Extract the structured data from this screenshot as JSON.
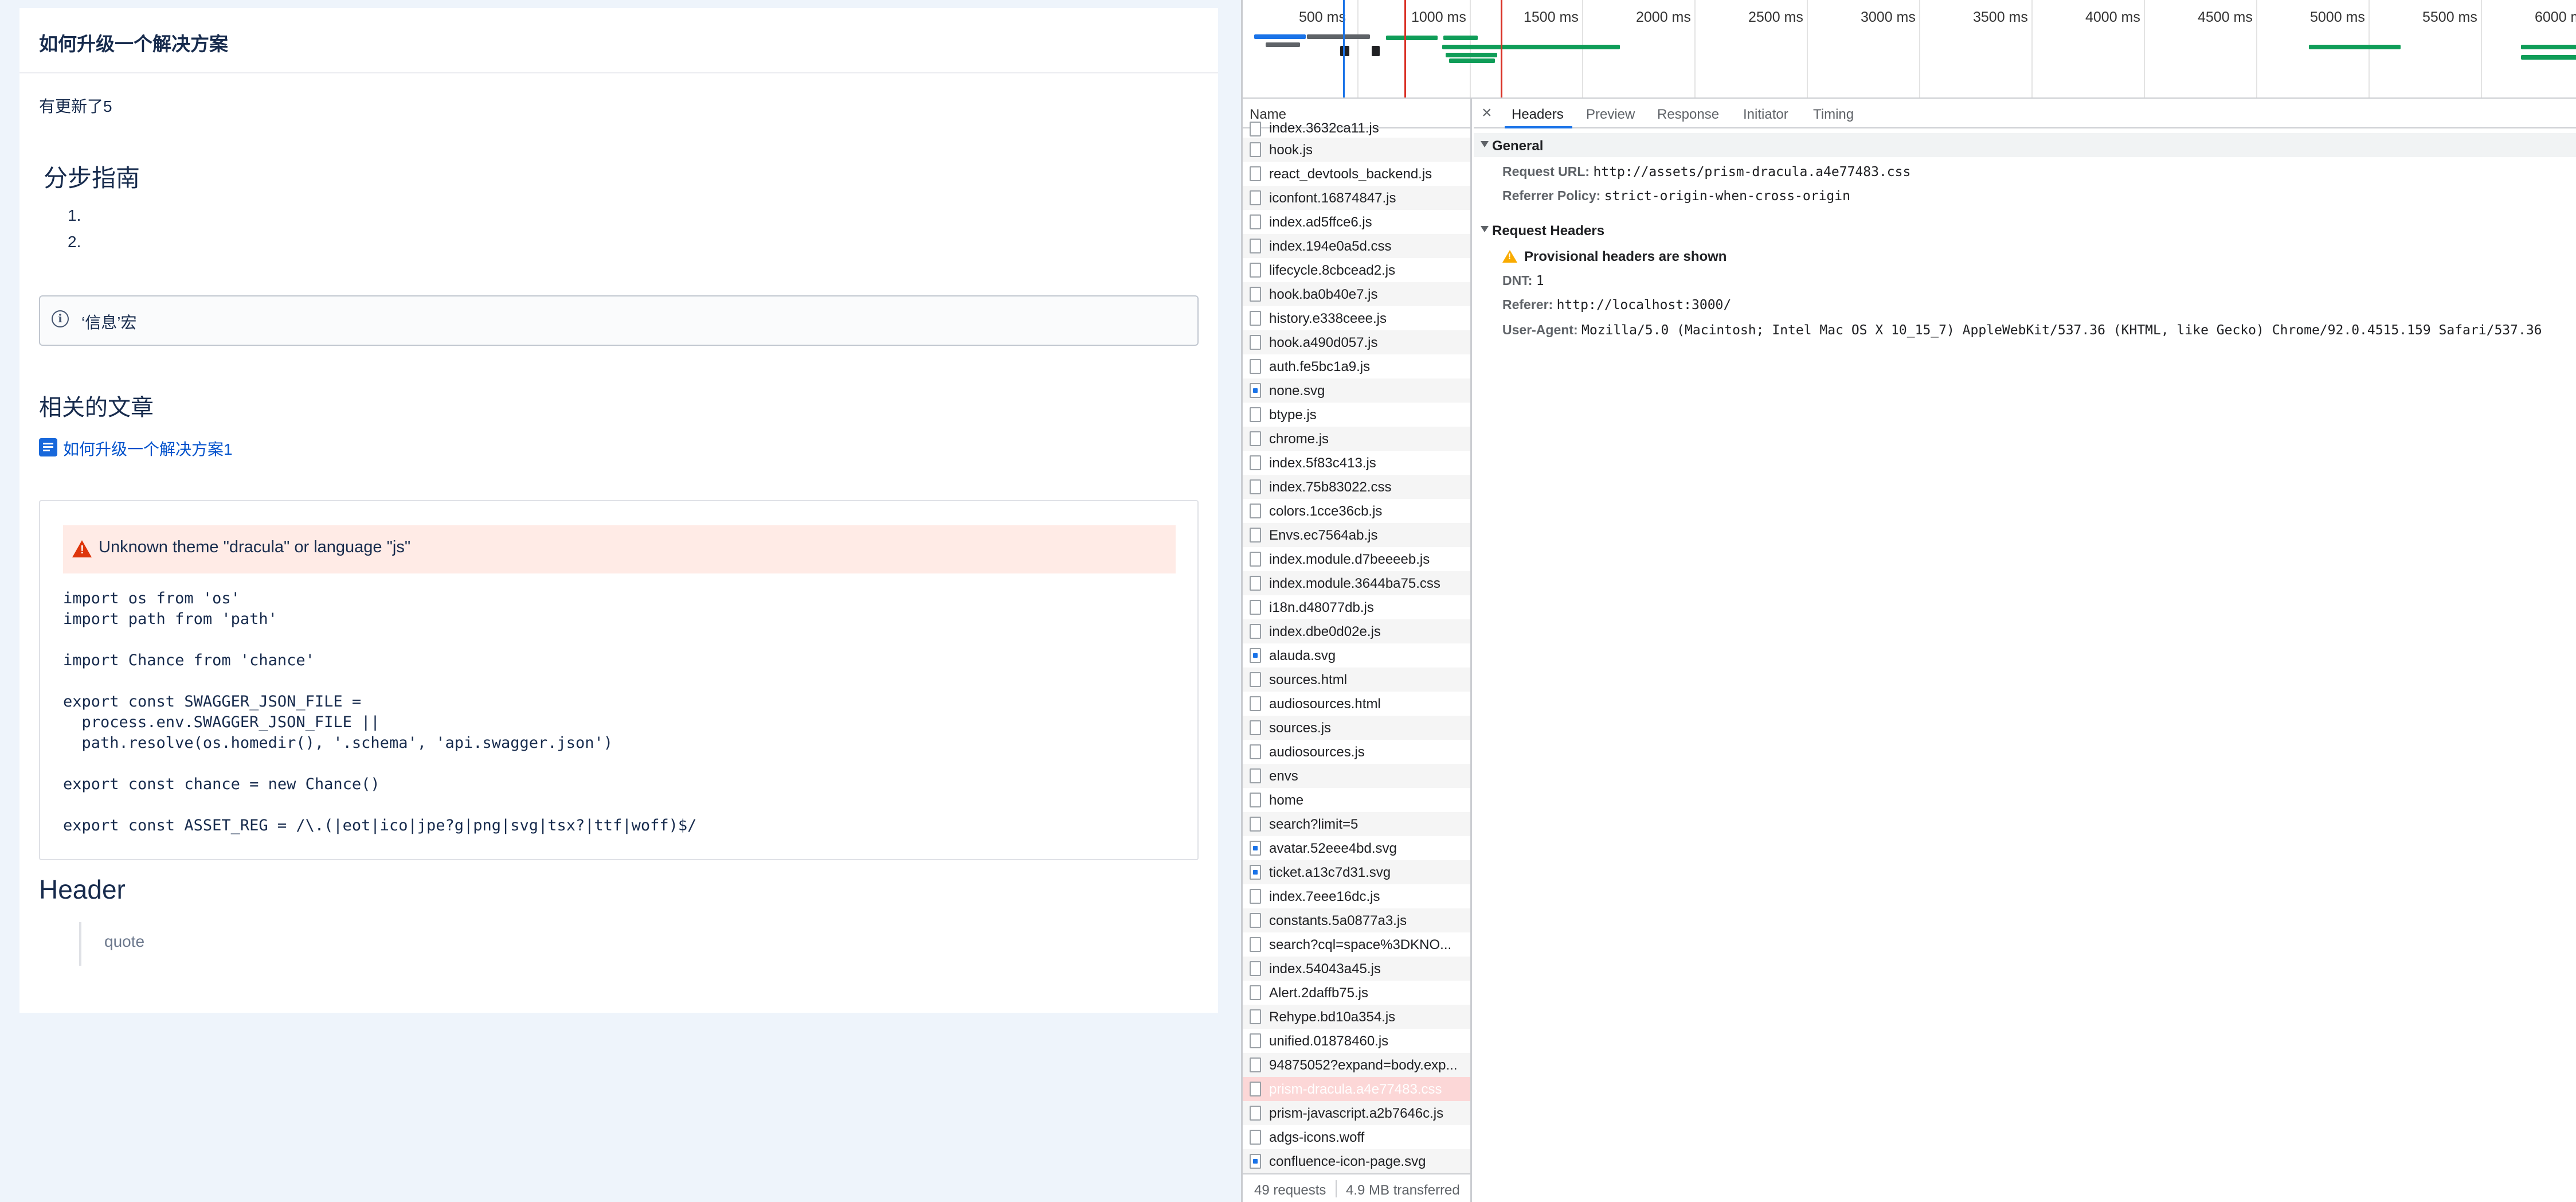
{
  "page": {
    "title": "如何升级一个解决方案",
    "updated_text": "有更新了5",
    "guide_heading": "分步指南",
    "ordered_list": [
      "1.",
      "2."
    ],
    "info_panel_text": "‘信息’宏",
    "related_heading": "相关的文章",
    "related_link": "如何升级一个解决方案1",
    "code_error": "Unknown theme \"dracula\" or language \"js\"",
    "code_lines": [
      "import os from 'os'",
      "import path from 'path'",
      "",
      "import Chance from 'chance'",
      "",
      "export const SWAGGER_JSON_FILE =",
      "  process.env.SWAGGER_JSON_FILE ||",
      "  path.resolve(os.homedir(), '.schema', 'api.swagger.json')",
      "",
      "export const chance = new Chance()",
      "",
      "export const ASSET_REG = /\\.(|eot|ico|jpe?g|png|svg|tsx?|ttf|woff)$/"
    ],
    "header_heading": "Header",
    "quote_text": "quote"
  },
  "devtools": {
    "timeline_ticks": [
      "500 ms",
      "1000 ms",
      "1500 ms",
      "2000 ms",
      "2500 ms",
      "3000 ms",
      "3500 ms",
      "4000 ms",
      "4500 ms",
      "5000 ms",
      "5500 ms",
      "6000 m"
    ],
    "name_header": "Name",
    "requests": [
      {
        "name": "index.3632ca11.js",
        "icon": "file"
      },
      {
        "name": "hook.js",
        "icon": "file"
      },
      {
        "name": "react_devtools_backend.js",
        "icon": "file"
      },
      {
        "name": "iconfont.16874847.js",
        "icon": "file"
      },
      {
        "name": "index.ad5ffce6.js",
        "icon": "file"
      },
      {
        "name": "index.194e0a5d.css",
        "icon": "file"
      },
      {
        "name": "lifecycle.8cbcead2.js",
        "icon": "file"
      },
      {
        "name": "hook.ba0b40e7.js",
        "icon": "file"
      },
      {
        "name": "history.e338ceee.js",
        "icon": "file"
      },
      {
        "name": "hook.a490d057.js",
        "icon": "file"
      },
      {
        "name": "auth.fe5bc1a9.js",
        "icon": "file"
      },
      {
        "name": "none.svg",
        "icon": "image"
      },
      {
        "name": "btype.js",
        "icon": "file"
      },
      {
        "name": "chrome.js",
        "icon": "file"
      },
      {
        "name": "index.5f83c413.js",
        "icon": "file"
      },
      {
        "name": "index.75b83022.css",
        "icon": "file"
      },
      {
        "name": "colors.1cce36cb.js",
        "icon": "file"
      },
      {
        "name": "Envs.ec7564ab.js",
        "icon": "file"
      },
      {
        "name": "index.module.d7beeeeb.js",
        "icon": "file"
      },
      {
        "name": "index.module.3644ba75.css",
        "icon": "file"
      },
      {
        "name": "i18n.d48077db.js",
        "icon": "file"
      },
      {
        "name": "index.dbe0d02e.js",
        "icon": "file"
      },
      {
        "name": "alauda.svg",
        "icon": "image"
      },
      {
        "name": "sources.html",
        "icon": "file"
      },
      {
        "name": "audiosources.html",
        "icon": "file"
      },
      {
        "name": "sources.js",
        "icon": "file"
      },
      {
        "name": "audiosources.js",
        "icon": "file"
      },
      {
        "name": "envs",
        "icon": "file"
      },
      {
        "name": "home",
        "icon": "file"
      },
      {
        "name": "search?limit=5",
        "icon": "file"
      },
      {
        "name": "avatar.52eee4bd.svg",
        "icon": "image"
      },
      {
        "name": "ticket.a13c7d31.svg",
        "icon": "image"
      },
      {
        "name": "index.7eee16dc.js",
        "icon": "file"
      },
      {
        "name": "constants.5a0877a3.js",
        "icon": "file"
      },
      {
        "name": "search?cql=space%3DKNO...",
        "icon": "file"
      },
      {
        "name": "index.54043a45.js",
        "icon": "file"
      },
      {
        "name": "Alert.2daffb75.js",
        "icon": "file"
      },
      {
        "name": "Rehype.bd10a354.js",
        "icon": "file"
      },
      {
        "name": "unified.01878460.js",
        "icon": "file"
      },
      {
        "name": "94875052?expand=body.exp...",
        "icon": "file"
      },
      {
        "name": "prism-dracula.a4e77483.css",
        "icon": "file",
        "selected": true
      },
      {
        "name": "prism-javascript.a2b7646c.js",
        "icon": "file"
      },
      {
        "name": "adgs-icons.woff",
        "icon": "file"
      },
      {
        "name": "confluence-icon-page.svg",
        "icon": "image"
      }
    ],
    "status": {
      "requests": "49 requests",
      "transferred": "4.9 MB transferred"
    },
    "tabs": [
      "Headers",
      "Preview",
      "Response",
      "Initiator",
      "Timing"
    ],
    "active_tab": "Headers",
    "general": {
      "title": "General",
      "request_url_label": "Request URL:",
      "request_url": "http://assets/prism-dracula.a4e77483.css",
      "referrer_policy_label": "Referrer Policy:",
      "referrer_policy": "strict-origin-when-cross-origin"
    },
    "request_headers": {
      "title": "Request Headers",
      "provisional_warning": "Provisional headers are shown",
      "dnt_label": "DNT:",
      "dnt": "1",
      "referer_label": "Referer:",
      "referer": "http://localhost:3000/",
      "user_agent_label": "User-Agent:",
      "user_agent": "Mozilla/5.0 (Macintosh; Intel Mac OS X 10_15_7) AppleWebKit/537.36 (KHTML, like Gecko) Chrome/92.0.4515.159 Safari/537.36"
    },
    "colors": {
      "selected_row": "#fcd7d7",
      "bar_green": "#0f9d58",
      "bar_blue": "#1a73e8",
      "marker_red": "#d93025",
      "tab_accent": "#1a73e8"
    }
  }
}
